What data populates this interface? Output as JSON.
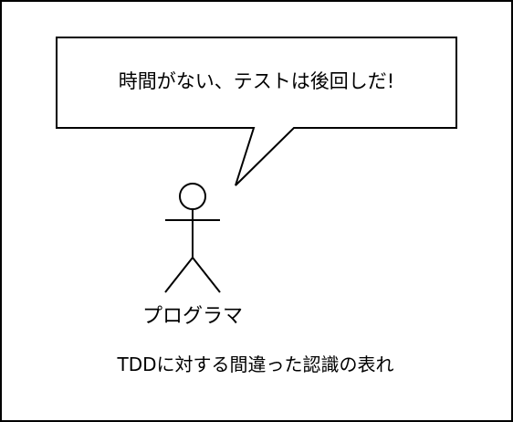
{
  "diagram": {
    "speech_bubble": {
      "text": "時間がない、テストは後回しだ!"
    },
    "actor": {
      "label": "プログラマ"
    },
    "caption": "TDDに対する間違った認識の表れ"
  }
}
